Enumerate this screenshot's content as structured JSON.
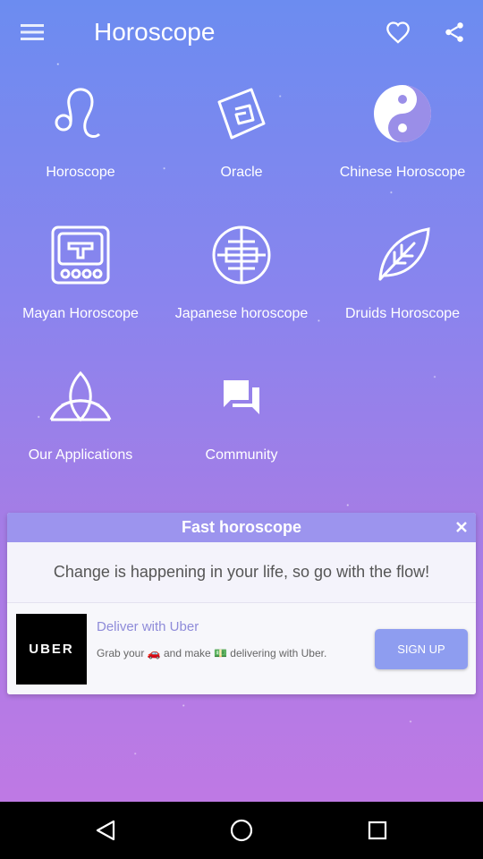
{
  "app_bar": {
    "title": "Horoscope",
    "menu_icon": "hamburger-menu-icon",
    "favorite_icon": "heart-icon",
    "share_icon": "share-icon"
  },
  "tiles": [
    {
      "label": "Horoscope",
      "icon": "leo-sign-icon"
    },
    {
      "label": "Oracle",
      "icon": "oracle-card-icon"
    },
    {
      "label": "Chinese Horoscope",
      "icon": "yin-yang-icon"
    },
    {
      "label": "Mayan Horoscope",
      "icon": "mayan-glyph-icon"
    },
    {
      "label": "Japanese horoscope",
      "icon": "japanese-emblem-icon"
    },
    {
      "label": "Druids Horoscope",
      "icon": "leaf-icon"
    },
    {
      "label": "Our Applications",
      "icon": "triquetra-icon"
    },
    {
      "label": "Community",
      "icon": "chat-bubbles-icon"
    }
  ],
  "popup": {
    "title": "Fast horoscope",
    "message": "Change is happening in your life, so go with the flow!",
    "close_icon": "close-icon"
  },
  "ad": {
    "logo_text": "UBER",
    "title": "Deliver with Uber",
    "description": "Grab your 🚗 and make 💵 delivering with Uber.",
    "cta": "SIGN UP"
  },
  "nav_bar": {
    "back_icon": "back-triangle-icon",
    "home_icon": "home-circle-icon",
    "recents_icon": "recents-square-icon"
  },
  "colors": {
    "background_top": "#6c8cf0",
    "background_bottom": "#c478e4",
    "popup_header": "#9c94ee",
    "ad_title": "#8e8bd9",
    "signup_button": "#8e9df0"
  }
}
